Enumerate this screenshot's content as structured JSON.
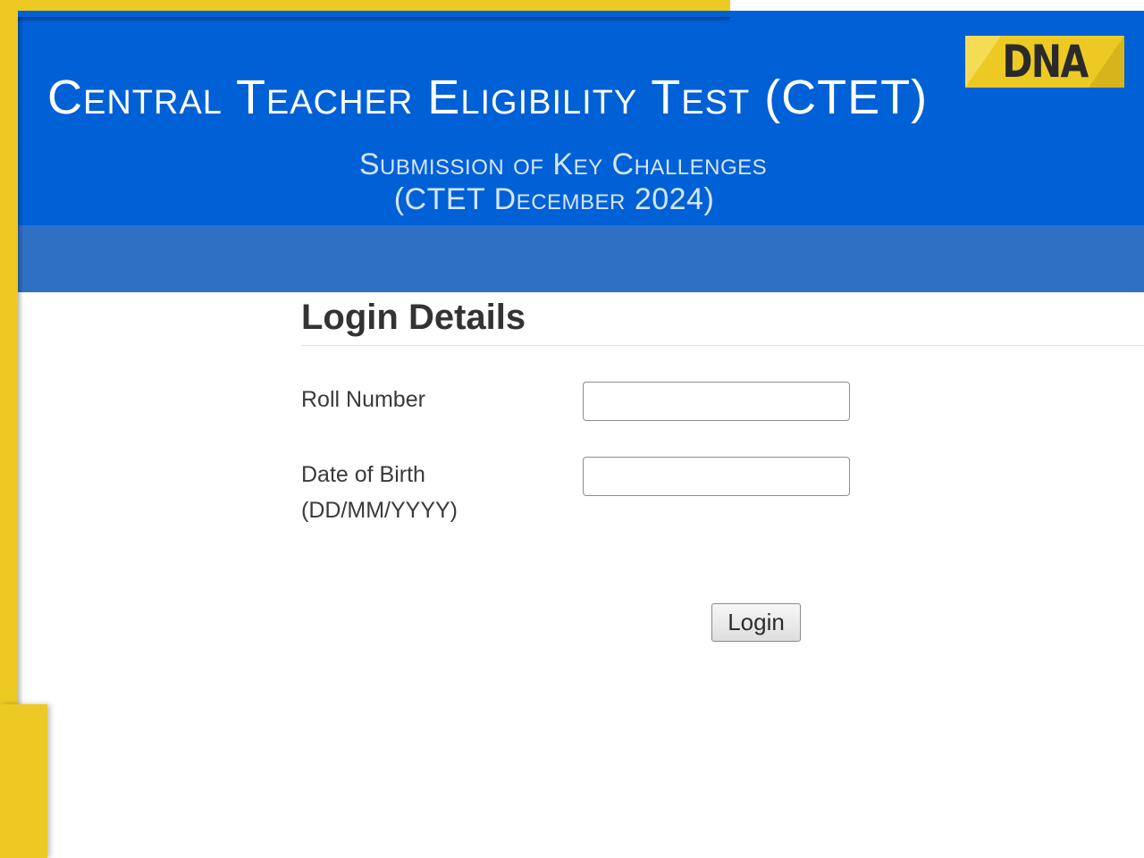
{
  "header": {
    "title": "Central Teacher Eligibility Test (CTET)",
    "subtitle_line1": "Submission of Key Challenges",
    "subtitle_line2": "(CTET December 2024)"
  },
  "watermark": {
    "logo_text": "DNA"
  },
  "login": {
    "heading": "Login Details",
    "roll_number_label": "Roll Number",
    "roll_number_value": "",
    "dob_label": "Date of Birth",
    "dob_format": "(DD/MM/YYYY)",
    "dob_value": "",
    "submit_label": "Login"
  },
  "colors": {
    "header_blue": "#0060d6",
    "nav_band_blue": "#2f6fc4",
    "frame_yellow": "#ecca23"
  }
}
